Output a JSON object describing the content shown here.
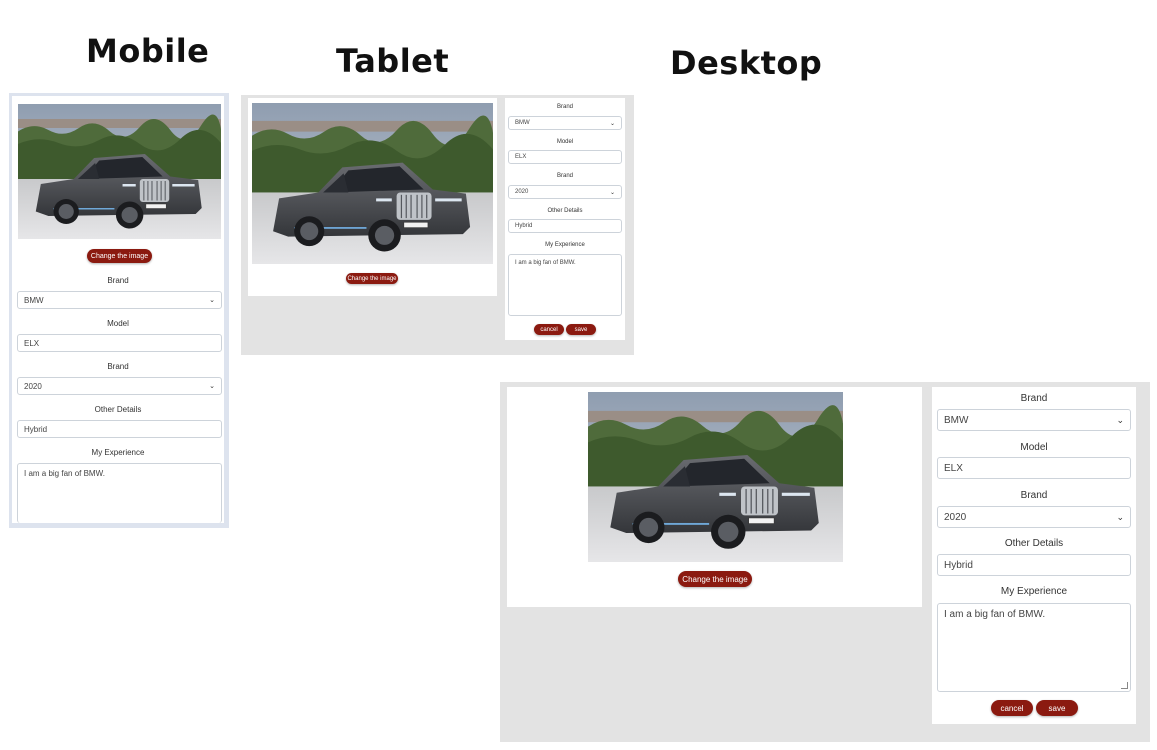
{
  "headings": {
    "mobile": "Mobile",
    "tablet": "Tablet",
    "desktop": "Desktop"
  },
  "form": {
    "change_image": "Change the image",
    "brand_label": "Brand",
    "brand_value": "BMW",
    "model_label": "Model",
    "model_value": "ELX",
    "year_label": "Brand",
    "year_value": "2020",
    "other_label": "Other Details",
    "other_value": "Hybrid",
    "experience_label": "My Experience",
    "experience_value": "I am a big fan of BMW.",
    "cancel": "cancel",
    "save": "save"
  },
  "colors": {
    "accent": "#8b1a10",
    "frame": "#e3e3e3",
    "mobile_frame": "#dde3ee"
  },
  "icons": {
    "select_chevron": "chevron-down-icon",
    "car_photo": "bmw-sedan-photo"
  }
}
